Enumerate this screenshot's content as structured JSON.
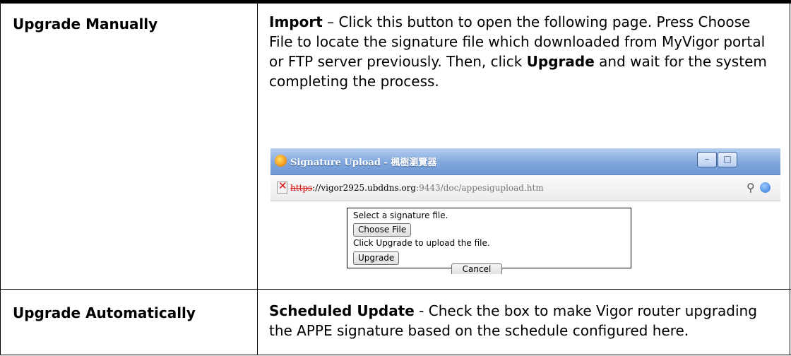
{
  "rows": [
    {
      "label": "Upgrade Manually",
      "desc": {
        "term": "Import",
        "sep": " – ",
        "text1": "Click this button to open the following page. Press Choose File to locate the signature file which downloaded from MyVigor portal or FTP server previously. Then, click ",
        "term2": "Upgrade",
        "text2": " and wait for the system completing the process."
      }
    },
    {
      "label": "Upgrade Automatically",
      "desc": {
        "term": "Scheduled Update",
        "sep": " - ",
        "text1": "Check the box to make Vigor router upgrading the APPE signature based on the schedule configured here."
      }
    }
  ],
  "popup": {
    "title": "Signature Upload - 楓樹瀏覽器",
    "url_scheme": "https",
    "url_host": "://vigor2925.ubddns.org",
    "url_path": ":9443/doc/appesigupload.htm",
    "win_minimize": "–",
    "win_restore": "□",
    "zoom_glyph": "⚲",
    "form": {
      "line1": "Select a signature file.",
      "choose_file": "Choose File",
      "line2": "Click Upgrade to upload the file.",
      "upgrade": "Upgrade",
      "cancel": "Cancel"
    }
  }
}
